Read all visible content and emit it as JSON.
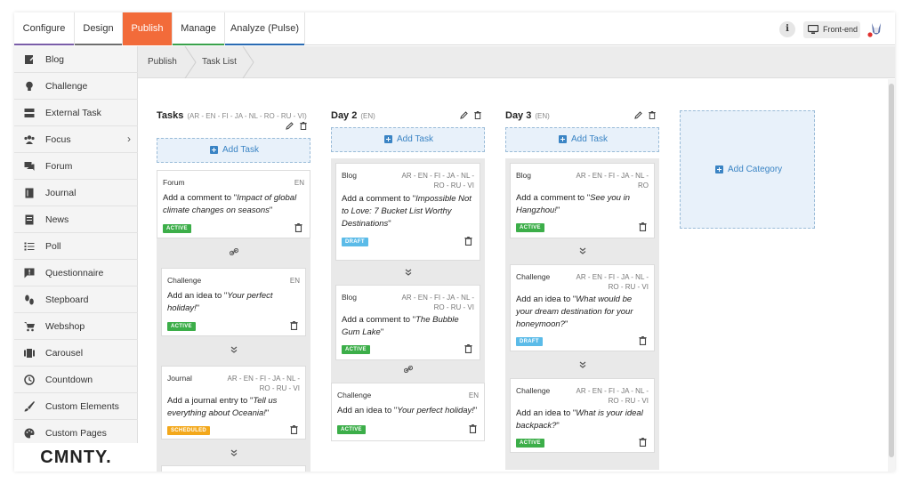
{
  "topnav": {
    "tabs": [
      {
        "label": "Configure",
        "underline": "#7a5da8"
      },
      {
        "label": "Design",
        "underline": "#6e6e6e"
      },
      {
        "label": "Publish",
        "underline": "#f26b3a"
      },
      {
        "label": "Manage",
        "underline": "#3aa24c"
      },
      {
        "label": "Analyze (Pulse)",
        "underline": "#2a6bb3"
      }
    ],
    "info_label": "i",
    "frontend_label": "Front-end"
  },
  "sidebar": {
    "items": [
      {
        "label": "Blog",
        "icon": "blog-icon"
      },
      {
        "label": "Challenge",
        "icon": "bulb-icon"
      },
      {
        "label": "External Task",
        "icon": "external-task-icon"
      },
      {
        "label": "Focus",
        "icon": "group-icon"
      },
      {
        "label": "Forum",
        "icon": "forum-icon"
      },
      {
        "label": "Journal",
        "icon": "journal-icon"
      },
      {
        "label": "News",
        "icon": "news-icon"
      },
      {
        "label": "Poll",
        "icon": "poll-icon"
      },
      {
        "label": "Questionnaire",
        "icon": "questionnaire-icon"
      },
      {
        "label": "Stepboard",
        "icon": "stepboard-icon"
      },
      {
        "label": "Webshop",
        "icon": "cart-icon"
      },
      {
        "label": "Carousel",
        "icon": "carousel-icon"
      },
      {
        "label": "Countdown",
        "icon": "clock-icon"
      },
      {
        "label": "Custom Elements",
        "icon": "brush-icon"
      },
      {
        "label": "Custom Pages",
        "icon": "palette-icon"
      }
    ],
    "focus_chevron": "›",
    "logo": "CMNTY."
  },
  "breadcrumb": {
    "items": [
      "Publish",
      "Task List"
    ]
  },
  "columns": [
    {
      "title": "Tasks",
      "langs": "(AR - EN - FI - JA - NL - RO - RU - VI)",
      "add_label": "Add Task",
      "cards": [
        {
          "type": "Forum",
          "langs": [
            "EN"
          ],
          "prefix": "Add a comment to \"",
          "title": "Impact of global climate changes on seasons",
          "suffix": "\"",
          "status": "ACTIVE",
          "connector": "link"
        },
        {
          "type": "Challenge",
          "langs": [
            "EN"
          ],
          "prefix": "Add an idea to \"",
          "title": "Your perfect holiday!",
          "suffix": "\"",
          "status": "ACTIVE",
          "connector": "chevron"
        },
        {
          "type": "Journal",
          "langs": [
            "AR - EN - FI - JA - NL -",
            "RO - RU - VI"
          ],
          "prefix": "Add a journal entry to \"",
          "title": "Tell us everything about Oceania!",
          "suffix": "\"",
          "status": "SCHEDULED",
          "connector": "chevron"
        }
      ]
    },
    {
      "title": "Day 2",
      "langs": "(EN)",
      "add_label": "Add Task",
      "cards": [
        {
          "type": "Blog",
          "langs": [
            "AR - EN - FI - JA - NL -",
            "RO - RU - VI"
          ],
          "prefix": "Add a comment to \"",
          "title": "Impossible Not to Love: 7 Bucket List Worthy Destinations",
          "suffix": "\"",
          "status": "DRAFT",
          "connector": "chevron"
        },
        {
          "type": "Blog",
          "langs": [
            "AR - EN - FI - JA - NL -",
            "RO - RU - VI"
          ],
          "prefix": "Add a comment to \"",
          "title": "The Bubble Gum Lake",
          "suffix": "\"",
          "status": "ACTIVE",
          "connector": "link"
        },
        {
          "type": "Challenge",
          "langs": [
            "EN"
          ],
          "prefix": "Add an idea to \"",
          "title": "Your perfect holiday!",
          "suffix": "\"",
          "status": "ACTIVE",
          "connector": ""
        }
      ]
    },
    {
      "title": "Day 3",
      "langs": "(EN)",
      "add_label": "Add Task",
      "cards": [
        {
          "type": "Blog",
          "langs": [
            "AR - EN - FI - JA - NL -",
            "RO"
          ],
          "prefix": "Add a comment to \"",
          "title": "See you in Hangzhou!",
          "suffix": "\"",
          "status": "ACTIVE",
          "connector": "chevron"
        },
        {
          "type": "Challenge",
          "langs": [
            "AR - EN - FI - JA - NL -",
            "RO - RU - VI"
          ],
          "prefix": "Add an idea to \"",
          "title": "What would be your dream destination for your honeymoon?",
          "suffix": "\"",
          "status": "DRAFT",
          "connector": "chevron"
        },
        {
          "type": "Challenge",
          "langs": [
            "AR - EN - FI - JA - NL -",
            "RO - RU - VI"
          ],
          "prefix": "Add an idea to \"",
          "title": "What is your ideal backpack?",
          "suffix": "\"",
          "status": "ACTIVE",
          "connector": ""
        }
      ]
    }
  ],
  "add_category_label": "Add Category",
  "colors": {
    "active": "#3cae49",
    "draft": "#5bbbe8",
    "scheduled": "#f3a81b",
    "accent": "#f26b3a",
    "link_blue": "#3a84c4"
  }
}
